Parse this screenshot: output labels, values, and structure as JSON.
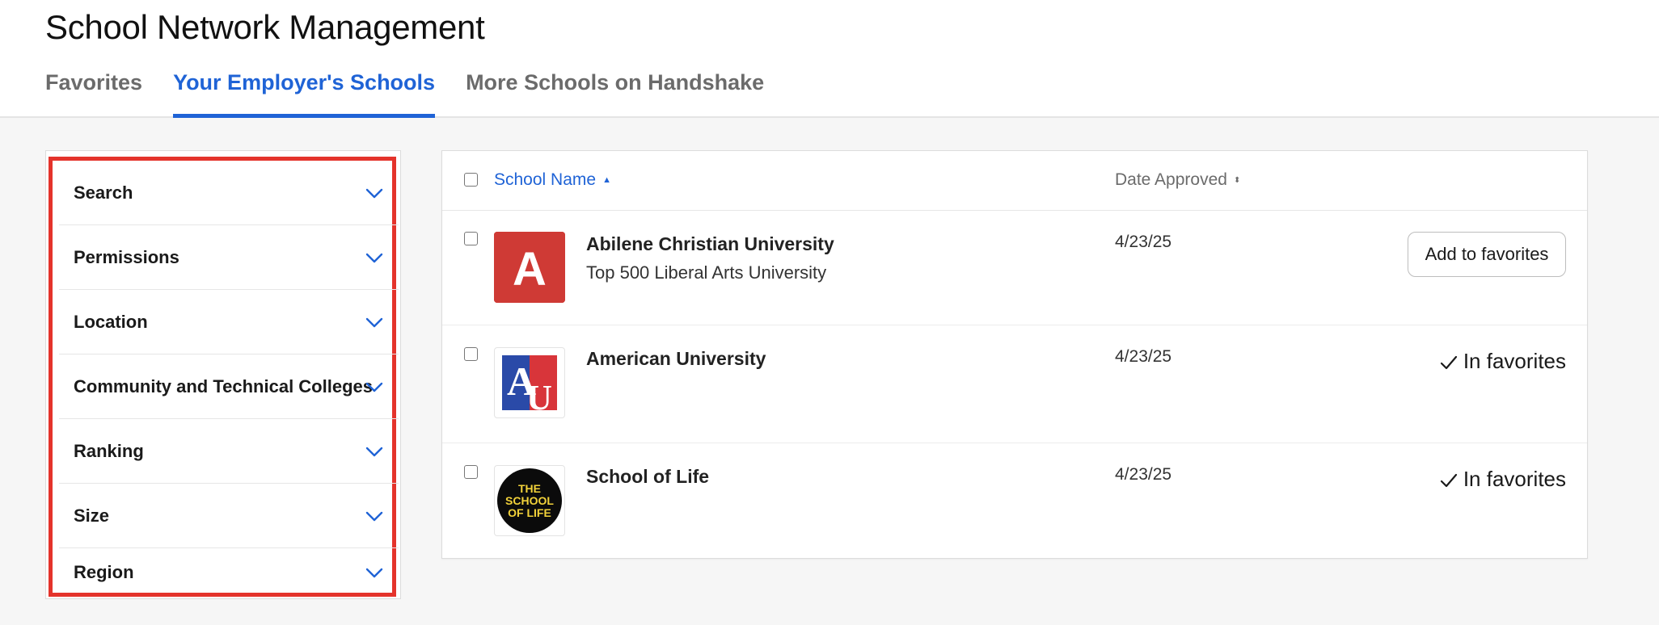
{
  "page": {
    "title": "School Network Management"
  },
  "tabs": [
    {
      "label": "Favorites",
      "active": false
    },
    {
      "label": "Your Employer's Schools",
      "active": true
    },
    {
      "label": "More Schools on Handshake",
      "active": false
    }
  ],
  "filters": [
    {
      "label": "Search",
      "icon": "chevron-down-icon"
    },
    {
      "label": "Permissions",
      "icon": "chevron-down-icon"
    },
    {
      "label": "Location",
      "icon": "chevron-down-icon"
    },
    {
      "label": "Community and Technical Colleges",
      "icon": "chevron-down-icon"
    },
    {
      "label": "Ranking",
      "icon": "chevron-down-icon"
    },
    {
      "label": "Size",
      "icon": "chevron-down-icon"
    },
    {
      "label": "Region",
      "icon": "chevron-down-icon"
    }
  ],
  "table": {
    "columns": {
      "name": "School Name",
      "name_sort_icon": "sort-ascending-icon",
      "date": "Date Approved",
      "date_sort_icon": "sort-icon"
    },
    "rows": [
      {
        "name": "Abilene Christian University",
        "subtitle": "Top 500 Liberal Arts University",
        "date": "4/23/25",
        "action": "Add to favorites",
        "logo": {
          "type": "letter",
          "text": "A",
          "bg": "#cf3a35",
          "fg": "#ffffff"
        }
      },
      {
        "name": "American University",
        "subtitle": "",
        "date": "4/23/25",
        "status": "In favorites",
        "logo": {
          "type": "au",
          "text": "AU",
          "colors": [
            "#2a4aa8",
            "#d8353a"
          ]
        }
      },
      {
        "name": "School of Life",
        "subtitle": "",
        "date": "4/23/25",
        "status": "In favorites",
        "logo": {
          "type": "circle",
          "lines": [
            "THE",
            "SCHOOL",
            "OF LIFE"
          ],
          "bg": "#0b0b0b",
          "fg": "#f2d23a"
        }
      }
    ]
  },
  "colors": {
    "accent": "#1f63d6",
    "highlight": "#e4332b",
    "muted_text": "#6b6b6b"
  }
}
